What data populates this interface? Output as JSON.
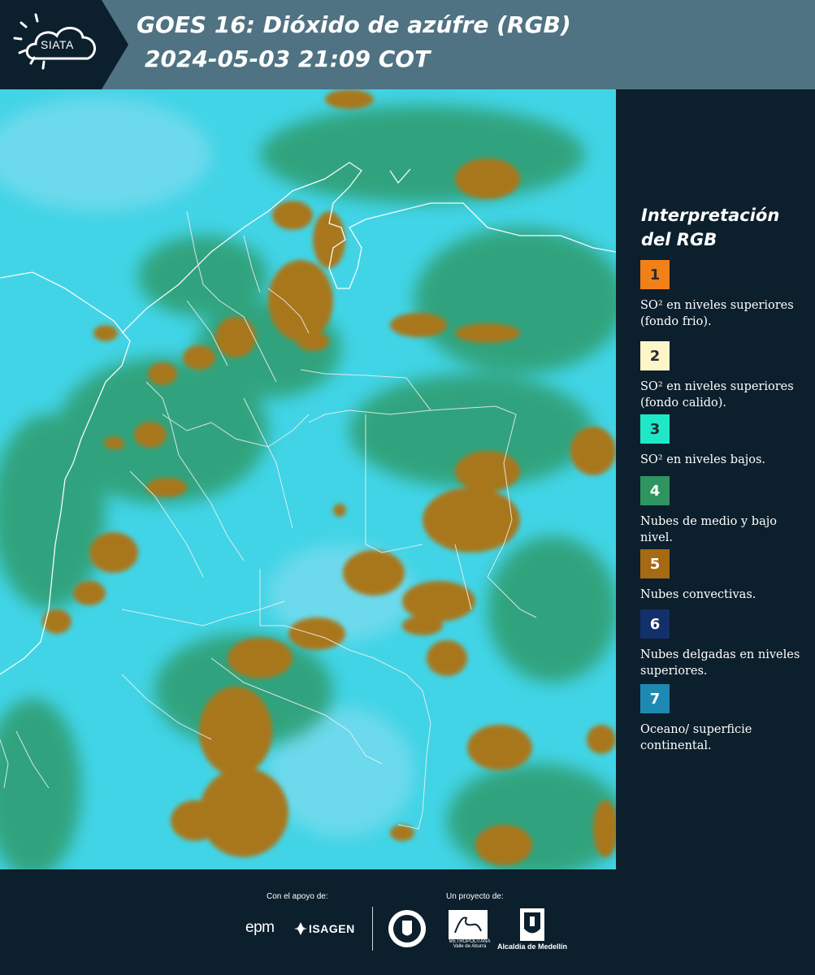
{
  "header": {
    "logo_text": "SIATA",
    "title_line1": "GOES 16: Dióxido de azúfre (RGB)",
    "title_line2": "2024-05-03 21:09 COT"
  },
  "legend": {
    "title": "Interpretación del RGB",
    "items": [
      {
        "number": "1",
        "color": "#f28019",
        "text": "SO² en niveles superiores (fondo frio)."
      },
      {
        "number": "2",
        "color": "#fdf6c8",
        "text": "SO² en niveles superiores (fondo calido)."
      },
      {
        "number": "3",
        "color": "#1fe8c9",
        "text": "SO² en niveles bajos."
      },
      {
        "number": "4",
        "color": "#2e9460",
        "text": "Nubes de medio y bajo nivel."
      },
      {
        "number": "5",
        "color": "#a66a12",
        "text": "Nubes convectivas."
      },
      {
        "number": "6",
        "color": "#12306a",
        "text": "Nubes delgadas en niveles superiores."
      },
      {
        "number": "7",
        "color": "#1e8ab4",
        "text": "Oceano/ superficie continental."
      }
    ]
  },
  "footer": {
    "support_label": "Con el apoyo de:",
    "project_label": "Un proyecto de:",
    "sponsor1": "epm",
    "sponsor2": "ISAGEN",
    "partner1": "METROPOLITANA Valle de Aburrá",
    "partner2": "Alcaldía de Medellín"
  },
  "map": {
    "background_color": "#3fd3e6",
    "convective_color": "#a8771f",
    "lowcloud_color": "#2e9a6a",
    "border_color": "#ffffff"
  }
}
